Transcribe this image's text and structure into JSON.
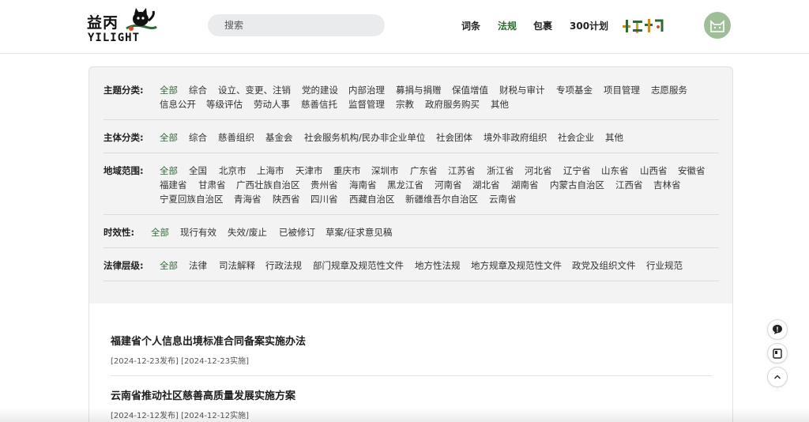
{
  "header": {
    "logo_cn": "益丙",
    "logo_en": "YILIGHT",
    "search_placeholder": "搜索",
    "nav": [
      {
        "label": "词条",
        "active": false
      },
      {
        "label": "法规",
        "active": true
      },
      {
        "label": "包裹",
        "active": false
      },
      {
        "label": "300计划",
        "active": false
      }
    ],
    "brand_color": "#2e6b34"
  },
  "filters": {
    "topic": {
      "label": "主题分类:",
      "options": [
        "全部",
        "综合",
        "设立、变更、注销",
        "党的建设",
        "内部治理",
        "募捐与捐赠",
        "保值增值",
        "财税与审计",
        "专项基金",
        "项目管理",
        "志愿服务",
        "信息公开",
        "等级评估",
        "劳动人事",
        "慈善信托",
        "监督管理",
        "宗教",
        "政府服务购买",
        "其他"
      ],
      "selected": "全部"
    },
    "subject": {
      "label": "主体分类:",
      "options": [
        "全部",
        "综合",
        "慈善组织",
        "基金会",
        "社会服务机构/民办非企业单位",
        "社会团体",
        "境外非政府组织",
        "社会企业",
        "其他"
      ],
      "selected": "全部"
    },
    "region": {
      "label": "地域范围:",
      "options": [
        "全部",
        "全国",
        "北京市",
        "上海市",
        "天津市",
        "重庆市",
        "深圳市",
        "广东省",
        "江苏省",
        "浙江省",
        "河北省",
        "辽宁省",
        "山东省",
        "山西省",
        "安徽省",
        "福建省",
        "甘肃省",
        "广西壮族自治区",
        "贵州省",
        "海南省",
        "黑龙江省",
        "河南省",
        "湖北省",
        "湖南省",
        "内蒙古自治区",
        "江西省",
        "吉林省",
        "宁夏回族自治区",
        "青海省",
        "陕西省",
        "四川省",
        "西藏自治区",
        "新疆维吾尔自治区",
        "云南省"
      ],
      "selected": "全部"
    },
    "validity": {
      "label": "时效性:",
      "options": [
        "全部",
        "现行有效",
        "失效/废止",
        "已被修订",
        "草案/征求意见稿"
      ],
      "selected": "全部"
    },
    "level": {
      "label": "法律层级:",
      "options": [
        "全部",
        "法律",
        "司法解释",
        "行政法规",
        "部门规章及规范性文件",
        "地方性法规",
        "地方规章及规范性文件",
        "政党及组织文件",
        "行业规范"
      ],
      "selected": "全部"
    }
  },
  "results": [
    {
      "title": "福建省个人信息出境标准合同备案实施办法",
      "meta": "[2024-12-23发布] [2024-12-23实施]"
    },
    {
      "title": "云南省推动社区慈善高质量发展实施方案",
      "meta": "[2024-12-12发布] [2024-12-12实施]"
    }
  ],
  "icons": {
    "chat": "chat-bubble-icon",
    "bookmark": "notebook-icon",
    "top": "chevron-up-icon"
  }
}
